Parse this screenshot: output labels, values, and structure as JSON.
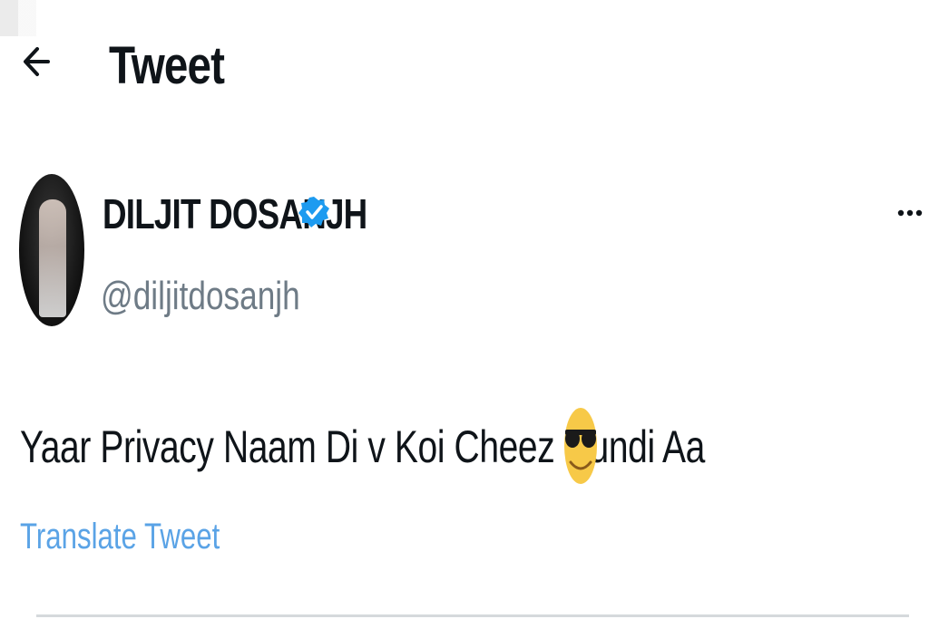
{
  "header": {
    "title": "Tweet",
    "back_icon": "back-arrow-icon"
  },
  "tweet": {
    "author": {
      "name": "DILJIT DOSANJH",
      "handle": "@diljitdosanjh",
      "verified_icon": "verified-badge-icon",
      "verified_color": "#1d9bf0"
    },
    "text": "Yaar Privacy Naam Di v Koi Cheez Hundi Aa",
    "emoji": "smiling-face-with-sunglasses",
    "translate_label": "Translate Tweet",
    "more_icon": "more-options-icon"
  },
  "colors": {
    "link": "#5aa3e6",
    "secondary_text": "#6e7b86",
    "primary_text": "#0f1419"
  }
}
